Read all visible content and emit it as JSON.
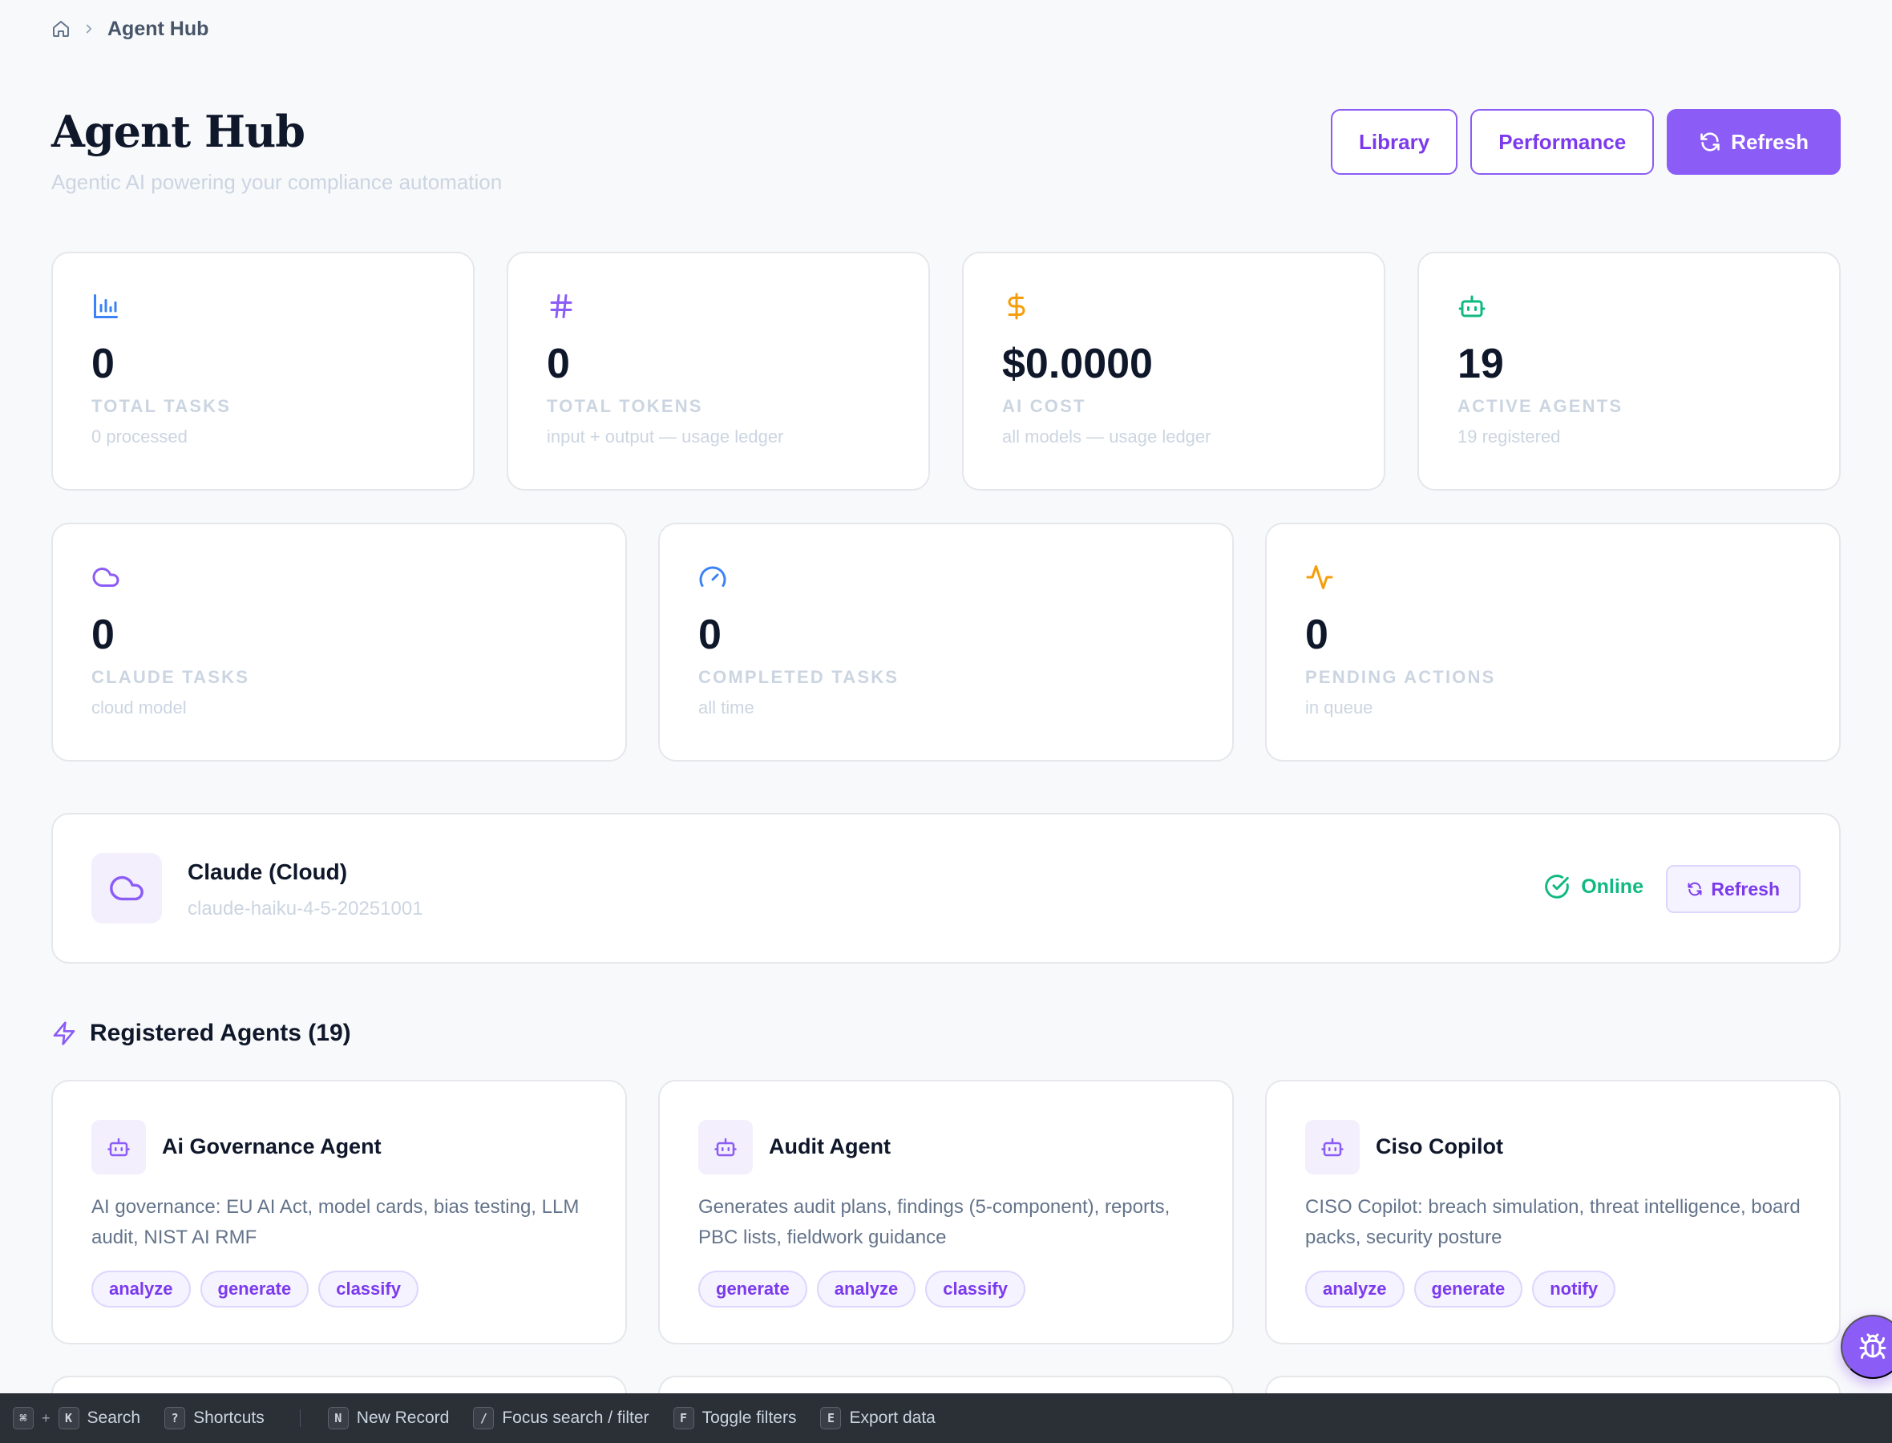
{
  "breadcrumb": {
    "current": "Agent Hub"
  },
  "header": {
    "title": "Agent Hub",
    "subtitle": "Agentic AI powering your compliance automation",
    "library_label": "Library",
    "performance_label": "Performance",
    "refresh_label": "Refresh"
  },
  "stats_row1": [
    {
      "icon": "bar-chart-icon",
      "color": "#3b82f6",
      "value": "0",
      "label": "TOTAL TASKS",
      "sub": "0 processed"
    },
    {
      "icon": "hash-icon",
      "color": "#8b5cf6",
      "value": "0",
      "label": "TOTAL TOKENS",
      "sub": "input + output — usage ledger"
    },
    {
      "icon": "dollar-icon",
      "color": "#f59e0b",
      "value": "$0.0000",
      "label": "AI COST",
      "sub": "all models — usage ledger"
    },
    {
      "icon": "robot-icon",
      "color": "#10b981",
      "value": "19",
      "label": "ACTIVE AGENTS",
      "sub": "19 registered"
    }
  ],
  "stats_row2": [
    {
      "icon": "cloud-icon",
      "color": "#8b5cf6",
      "value": "0",
      "label": "CLAUDE TASKS",
      "sub": "cloud model"
    },
    {
      "icon": "gauge-icon",
      "color": "#3b82f6",
      "value": "0",
      "label": "COMPLETED TASKS",
      "sub": "all time"
    },
    {
      "icon": "activity-icon",
      "color": "#f59e0b",
      "value": "0",
      "label": "PENDING ACTIONS",
      "sub": "in queue"
    }
  ],
  "model": {
    "name": "Claude (Cloud)",
    "id": "claude-haiku-4-5-20251001",
    "status": "Online",
    "status_color": "#10b981",
    "refresh_label": "Refresh"
  },
  "agents_section": {
    "title": "Registered Agents (19)"
  },
  "agents": [
    {
      "name": "Ai Governance Agent",
      "description": "AI governance: EU AI Act, model cards, bias testing, LLM audit, NIST AI RMF",
      "tags": [
        "analyze",
        "generate",
        "classify"
      ]
    },
    {
      "name": "Audit Agent",
      "description": "Generates audit plans, findings (5-component), reports, PBC lists, fieldwork guidance",
      "tags": [
        "generate",
        "analyze",
        "classify"
      ]
    },
    {
      "name": "Ciso Copilot",
      "description": "CISO Copilot: breach simulation, threat intelligence, board packs, security posture",
      "tags": [
        "analyze",
        "generate",
        "notify"
      ]
    }
  ],
  "shortcuts": {
    "search": {
      "keys": [
        "⌘",
        "K"
      ],
      "label": "Search"
    },
    "help": {
      "key": "?",
      "label": "Shortcuts"
    },
    "items": [
      {
        "key": "N",
        "label": "New Record"
      },
      {
        "key": "/",
        "label": "Focus search / filter"
      },
      {
        "key": "F",
        "label": "Toggle filters"
      },
      {
        "key": "E",
        "label": "Export data"
      }
    ]
  },
  "colors": {
    "accent": "#8b5cf6",
    "accent_dark": "#7c3aed"
  }
}
